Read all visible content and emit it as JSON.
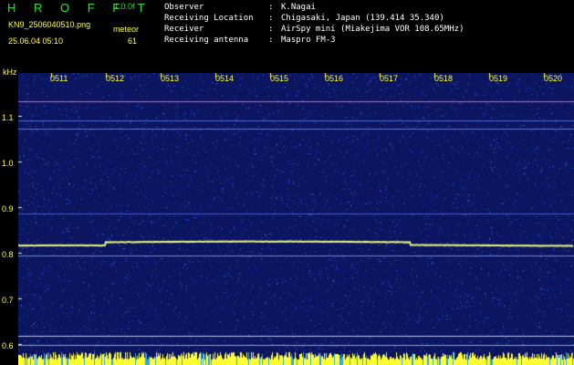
{
  "header": {
    "title": "H R O F F T",
    "version": "1.0.0f",
    "filename": "KN9_2506040510.png",
    "datetime": "25.06.04 05:10",
    "meteor_label": "meteor",
    "meteor_count": "61"
  },
  "station": [
    {
      "key": "Observer",
      "sep": ":",
      "value": "K.Nagai"
    },
    {
      "key": "Receiving Location",
      "sep": ":",
      "value": "Chigasaki, Japan (139.414 35.340)"
    },
    {
      "key": "Receiver",
      "sep": ":",
      "value": "AirSpy mini (Miakejima VOR 108.65MHz)"
    },
    {
      "key": "Receiving antenna",
      "sep": ":",
      "value": "Maspro FM-3"
    }
  ],
  "axis": {
    "unit": "kHz",
    "y_ticks": [
      "1.1",
      "1.0",
      "0.9",
      "0.8",
      "0.7",
      "0.6"
    ],
    "time_ticks": [
      "0511",
      "0512",
      "0513",
      "0514",
      "0515",
      "0516",
      "0517",
      "0518",
      "0519",
      "0520"
    ]
  },
  "colors": {
    "background": "#000000",
    "plot_bg": "#0b1560",
    "header_green": "#2fe02f",
    "label_yellow": "#ffff33",
    "trace_main": "#e6f57a",
    "trace_top": "#ff66aa",
    "noise_strip": "#ffff33"
  }
}
